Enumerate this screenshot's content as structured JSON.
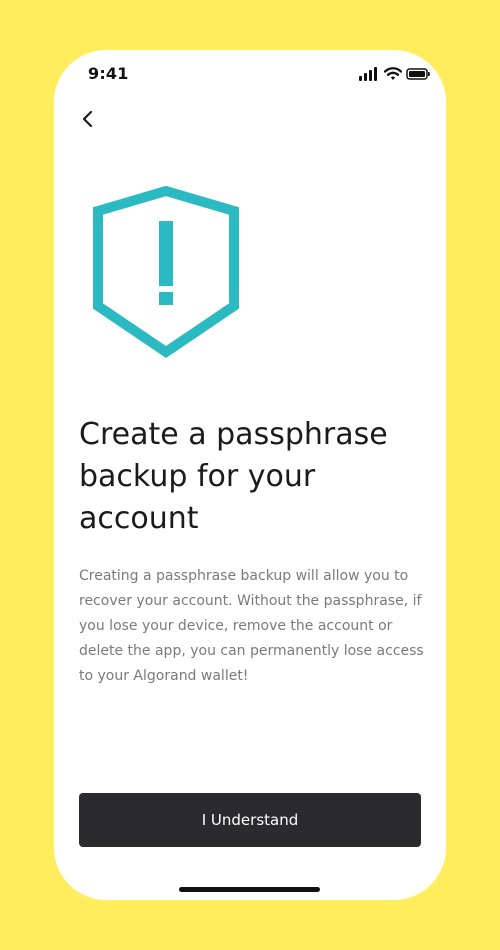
{
  "status_bar": {
    "time": "9:41",
    "signal_icon": "cellular-signal-icon",
    "wifi_icon": "wifi-icon",
    "battery_icon": "battery-icon"
  },
  "navigation": {
    "back_icon": "chevron-left-icon"
  },
  "hero": {
    "icon": "shield-warning-icon",
    "icon_color": "#2bb9c2"
  },
  "content": {
    "title": "Create a passphrase backup for your account",
    "body": "Creating a passphrase backup will allow you to recover your account. Without the passphrase, if you lose your device, remove the account or delete the app, you can permanently lose access to your Algorand wallet!"
  },
  "actions": {
    "primary_label": "I Understand"
  },
  "colors": {
    "background": "#ffed5d",
    "button": "#2b2b2d",
    "accent": "#2bb9c2"
  }
}
